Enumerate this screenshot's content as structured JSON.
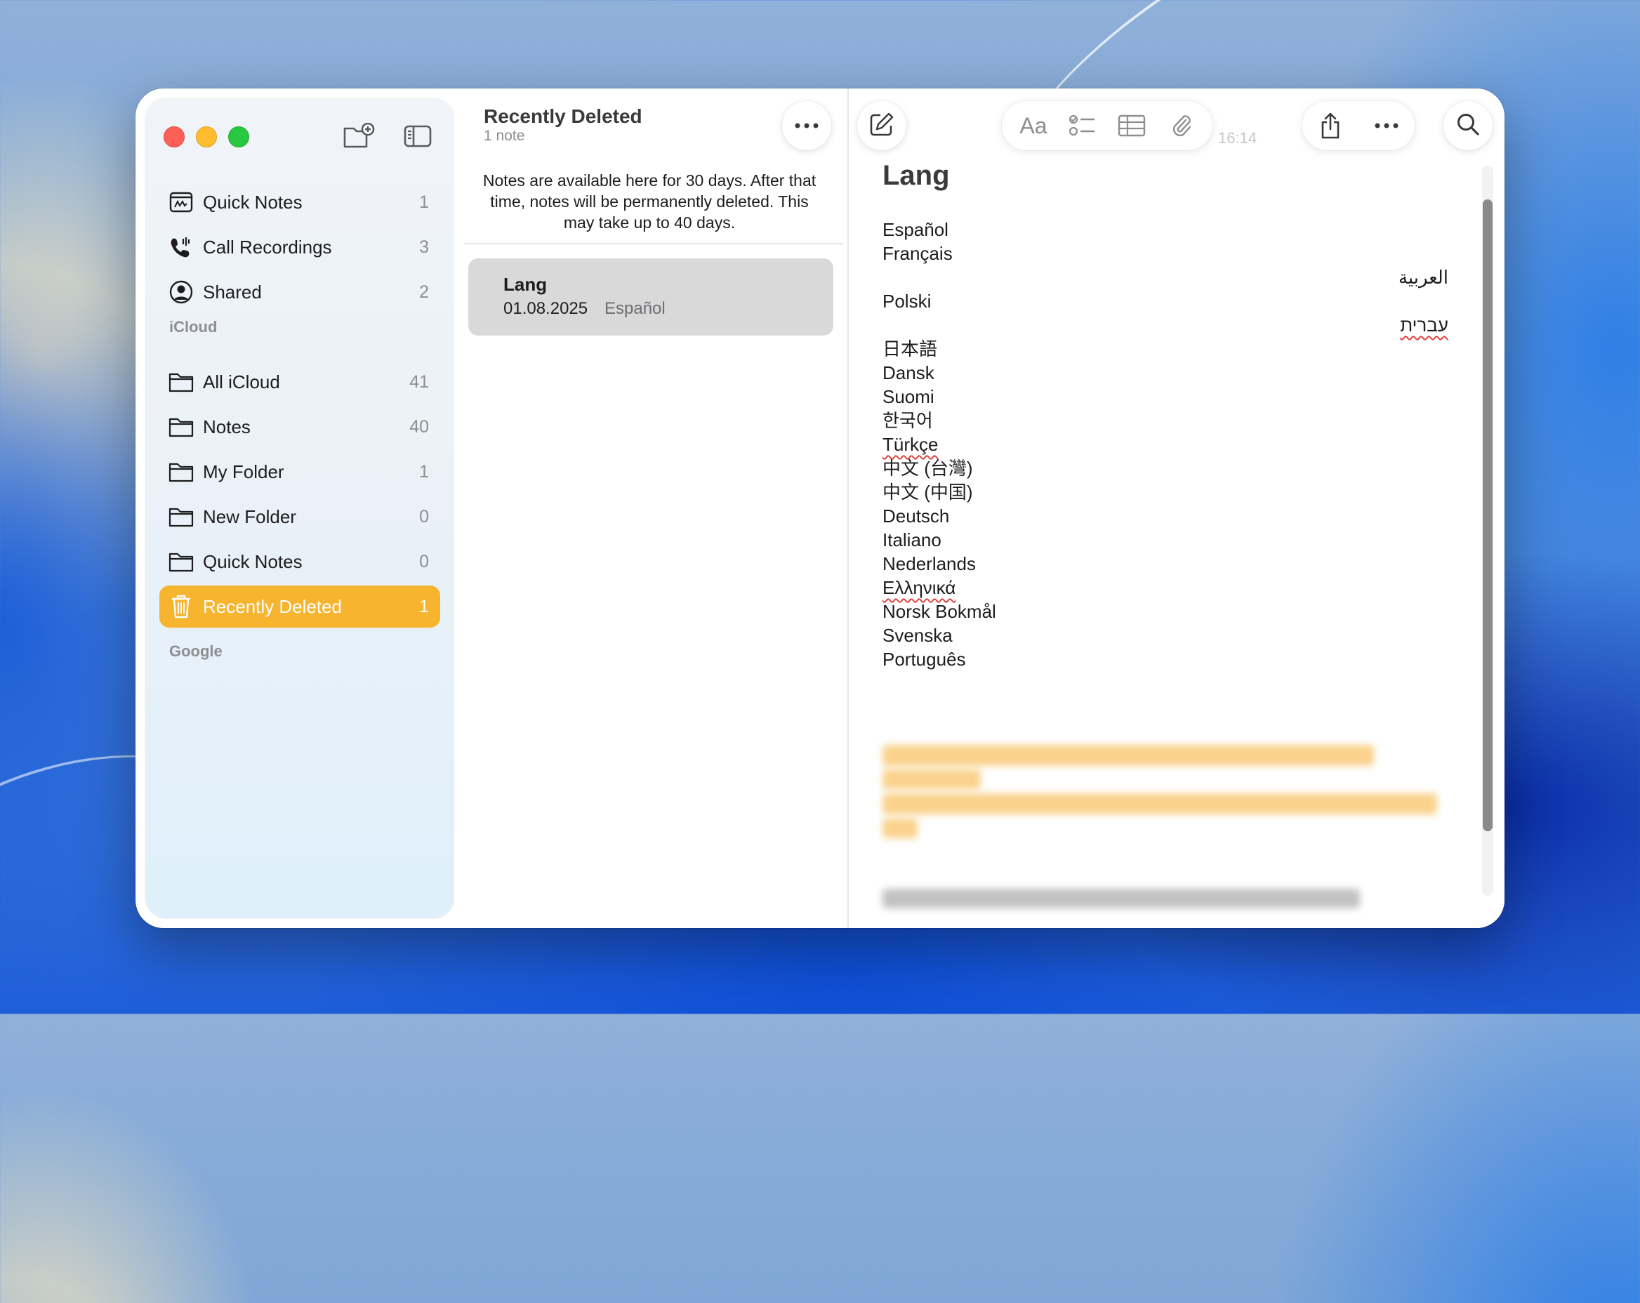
{
  "sidebar": {
    "pinned": [
      {
        "label": "Quick Notes",
        "count": "1",
        "icon": "quick-notes-icon"
      },
      {
        "label": "Call Recordings",
        "count": "3",
        "icon": "phone-waveform-icon"
      },
      {
        "label": "Shared",
        "count": "2",
        "icon": "person-circle-icon"
      }
    ],
    "section_icloud": "iCloud",
    "folders": [
      {
        "label": "All iCloud",
        "count": "41"
      },
      {
        "label": "Notes",
        "count": "40"
      },
      {
        "label": "My Folder",
        "count": "1"
      },
      {
        "label": "New Folder",
        "count": "0"
      },
      {
        "label": "Quick Notes",
        "count": "0"
      }
    ],
    "active": {
      "label": "Recently Deleted",
      "count": "1"
    },
    "section_google": "Google"
  },
  "list": {
    "title": "Recently Deleted",
    "subtitle": "1 note",
    "info": "Notes are available here for 30 days. After that time, notes will be permanently deleted. This may take up to 40 days.",
    "note": {
      "title": "Lang",
      "date": "01.08.2025",
      "preview": "Español"
    }
  },
  "editor": {
    "toolbar": {
      "format_label": "Aa"
    },
    "timestamp": "16:14",
    "title": "Lang",
    "lines": [
      "Español",
      "Français",
      "العربية",
      "Polski",
      "עברית",
      "日本語",
      "Dansk",
      "Suomi",
      "한국어",
      "Türkçe",
      "中文 (台灣)",
      "中文 (中国)",
      "Deutsch",
      "Italiano",
      "Nederlands",
      "Ελληνικά",
      "Norsk Bokmål",
      "Svenska",
      "Português"
    ]
  },
  "colors": {
    "accent": "#f7b42f",
    "close": "#fe5f57",
    "minimize": "#febc2e",
    "zoom": "#28c840"
  }
}
